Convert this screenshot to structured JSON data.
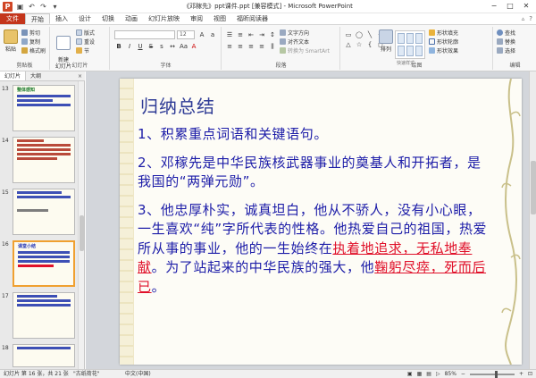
{
  "window": {
    "title": "《邓稼先》ppt课件.ppt [兼容模式] - Microsoft PowerPoint",
    "app_icon": "P",
    "quick_access": [
      "save-icon",
      "undo-icon",
      "redo-icon",
      "customize-icon"
    ],
    "controls": [
      "minimize-icon",
      "maximize-icon",
      "close-icon"
    ]
  },
  "tabs": [
    {
      "label": "文件"
    },
    {
      "label": "开始"
    },
    {
      "label": "插入"
    },
    {
      "label": "设计"
    },
    {
      "label": "切换"
    },
    {
      "label": "动画"
    },
    {
      "label": "幻灯片放映"
    },
    {
      "label": "审阅"
    },
    {
      "label": "视图"
    },
    {
      "label": "福昕阅读器"
    }
  ],
  "ribbon": {
    "clipboard": {
      "paste": "粘贴",
      "cut": "剪切",
      "copy": "复制",
      "format_painter": "格式刷",
      "label": "剪贴板"
    },
    "slides": {
      "new_slide": "新建\n幻灯片",
      "layout": "版式",
      "reset": "重设",
      "section": "节",
      "label": "幻灯片"
    },
    "font": {
      "font_size": "12",
      "bold": "B",
      "italic": "I",
      "underline": "U",
      "strike": "S",
      "label": "字体"
    },
    "paragraph": {
      "text_direction": "文字方向",
      "align_text": "对齐文本",
      "smartart": "转换为 SmartArt",
      "label": "段落"
    },
    "drawing": {
      "arrange": "排列",
      "quick_styles": "快速样式",
      "shape_fill": "形状填充",
      "shape_outline": "形状轮廓",
      "shape_effects": "形状效果",
      "label": "绘图"
    },
    "editing": {
      "find": "查找",
      "replace": "替换",
      "select": "选择",
      "label": "编辑"
    }
  },
  "left_pane": {
    "tabs": [
      "幻灯片",
      "大纲"
    ],
    "close": "×",
    "thumbnails": [
      {
        "num": "13",
        "title": "整体感知"
      },
      {
        "num": "14",
        "title": ""
      },
      {
        "num": "15",
        "title": ""
      },
      {
        "num": "16",
        "title": "课堂小结"
      },
      {
        "num": "17",
        "title": ""
      },
      {
        "num": "18",
        "title": ""
      }
    ]
  },
  "slide": {
    "title": "归纳总结",
    "para1": "1、积累重点词语和关键语句。",
    "para2": "2、邓稼先是中华民族核武器事业的奠基人和开拓者，是我国的“两弹元勋”。",
    "para3_a": "3、他忠厚朴实，诚真坦白，他从不骄人，没有小心眼，一生喜欢“纯”字所代表的性格。他热爱自己的祖国，热爱所从事的事业，他的一生始终在",
    "para3_red1": "执着地追求，无私地奉献",
    "para3_b": "。为了站起来的中华民族的强大，他",
    "para3_red2": "鞠躬尽瘁，死而后已",
    "para3_c": "。"
  },
  "status": {
    "slide_info": "幻灯片 第 16 张，共 21 张",
    "theme": "\"古纸荷花\"",
    "language": "中文(中国)",
    "zoom": "85%"
  }
}
